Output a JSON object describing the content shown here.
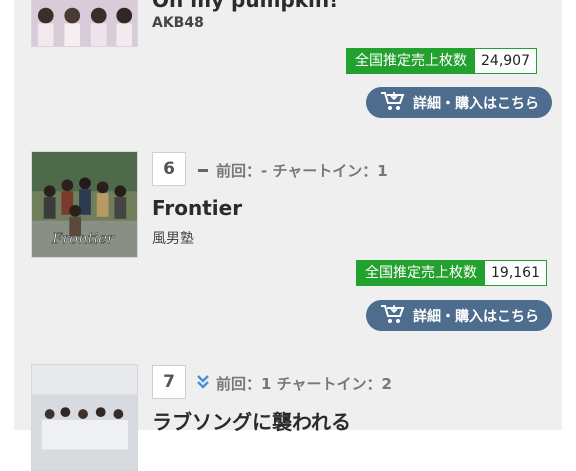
{
  "entries": [
    {
      "title": "Oh my pumpkin!",
      "artist": "AKB48",
      "sales_label": "全国推定売上枚数",
      "sales_value": "24,907",
      "button_label": "詳細・購入はこちら"
    },
    {
      "rank": "6",
      "meta": "前回：- チャートイン：1",
      "title": "Frontier",
      "artist": "風男塾",
      "sales_label": "全国推定売上枚数",
      "sales_value": "19,161",
      "button_label": "詳細・購入はこちら"
    },
    {
      "rank": "7",
      "meta": "前回：1 チャートイン：2",
      "title": "ラブソングに襲われる"
    }
  ],
  "icons": {
    "trend_same": "dash-icon",
    "trend_down": "double-chevron-down-icon",
    "cart": "cart-icon"
  },
  "colors": {
    "sales_green": "#23a12f",
    "button_blue": "#4e6c8d",
    "down_arrow": "#4a8fd8"
  }
}
